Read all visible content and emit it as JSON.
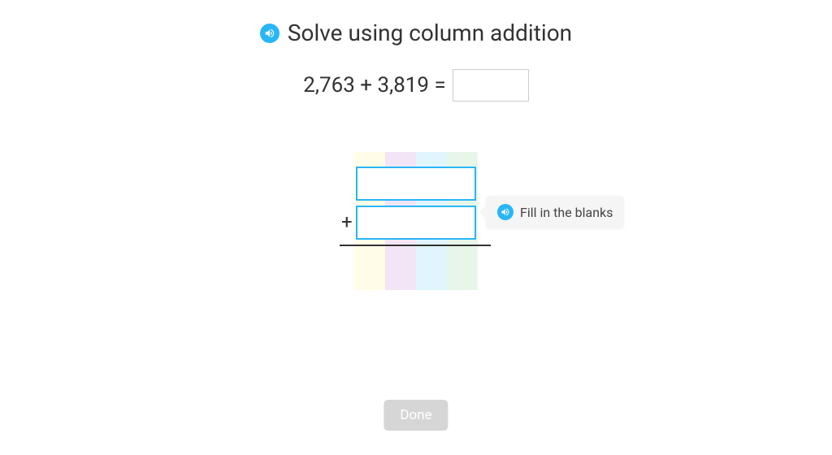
{
  "title": "Solve using column addition",
  "equation": {
    "text": "2,763 + 3,819 ="
  },
  "column": {
    "plus": "+",
    "addend1_value": "",
    "addend2_value": ""
  },
  "tooltip": {
    "text": "Fill in the blanks"
  },
  "buttons": {
    "done": "Done"
  }
}
